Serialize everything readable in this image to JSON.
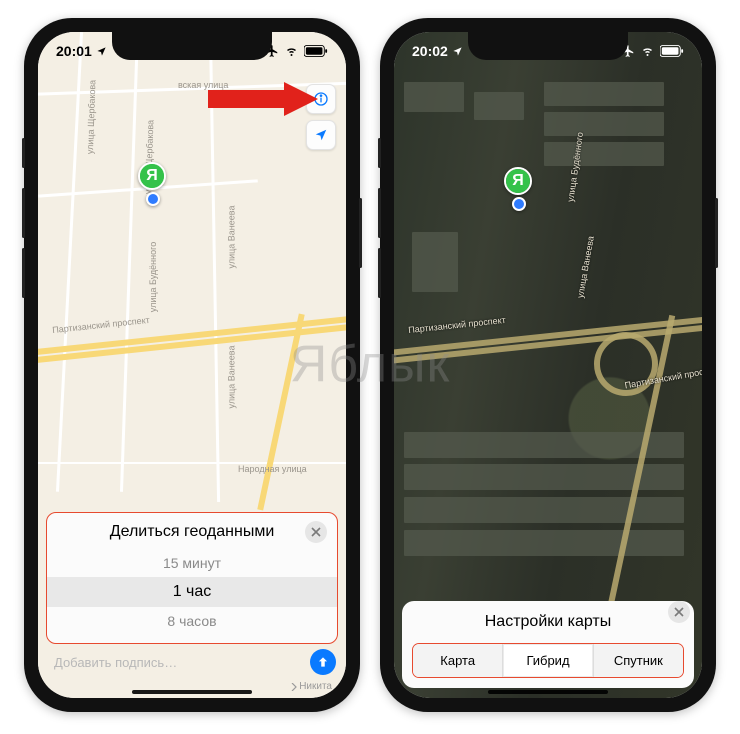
{
  "watermark": "Яблык",
  "left": {
    "status": {
      "time": "20:01"
    },
    "marker_letter": "Я",
    "marker_color": "#34c24a",
    "streets": {
      "sherbakova": "улица Щербакова",
      "nevskaya": "вская улица",
      "budennogo": "улица Будённого",
      "vaneeva": "улица Ванеева",
      "partizansky": "Партизанский проспект",
      "narodnaya": "Народная улица"
    },
    "share": {
      "title": "Делиться геоданными",
      "options": [
        "15 минут",
        "1 час",
        "8 часов"
      ],
      "selected_index": 1
    },
    "compose": {
      "placeholder": "Добавить подпись…",
      "recipient": "Никита"
    }
  },
  "right": {
    "status": {
      "time": "20:02"
    },
    "marker_letter": "Я",
    "marker_color": "#34c24a",
    "streets": {
      "budennogo": "улица Будённого",
      "vaneeva": "улица Ванеева",
      "partizansky": "Партизанский проспект"
    },
    "settings": {
      "title": "Настройки карты",
      "options": [
        "Карта",
        "Гибрид",
        "Спутник"
      ],
      "selected_index": 1
    }
  }
}
